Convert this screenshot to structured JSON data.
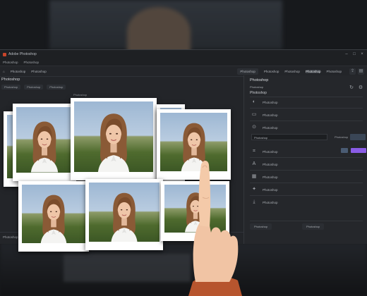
{
  "titlebar": {
    "title": "Adobe Photoshop"
  },
  "menubar": {
    "items": [
      "Photoshop",
      "Photoshop"
    ]
  },
  "toolbar": {
    "left": [
      "Photoshop",
      "Photoshop"
    ],
    "tabs": [
      "Photoshop",
      "Photoshop",
      "Photoshop",
      "Photoshop",
      "Photoshop"
    ]
  },
  "left_pane": {
    "title": "Photoshop",
    "subbar": [
      "Photoshop",
      "Photoshop",
      "Photoshop"
    ],
    "caption": "Photoshop",
    "bottom_label": "Photoshop"
  },
  "right_pane": {
    "heading": "Photoshop",
    "sub1": "Photoshop",
    "sub2": "Photoshop",
    "items": [
      {
        "label": "Photoshop",
        "icon": "contrast-icon"
      },
      {
        "label": "Photoshop",
        "icon": "layers-icon"
      },
      {
        "label": "Photoshop",
        "icon": "adjust-icon"
      },
      {
        "label": "Photoshop",
        "icon": "crop-icon"
      },
      {
        "label": "Photoshop",
        "icon": "text-icon"
      },
      {
        "label": "Photoshop",
        "icon": "image-icon"
      },
      {
        "label": "Photoshop",
        "icon": "effects-icon"
      },
      {
        "label": "Photoshop",
        "icon": "export-icon"
      }
    ],
    "field_value": "Photoshop",
    "field_label": "Photoshop",
    "footer_buttons": [
      "Photoshop",
      "Photoshop"
    ]
  },
  "photos": [
    {
      "tag": ""
    },
    {
      "tag": ""
    },
    {
      "tag": ""
    },
    {
      "tag": ""
    },
    {
      "tag": ""
    },
    {
      "tag": ""
    },
    {
      "tag": ""
    },
    {
      "tag": ""
    }
  ],
  "colors": {
    "accent": "#8a5ce6",
    "window_bg": "#232529",
    "panel_bg": "#25272b"
  }
}
